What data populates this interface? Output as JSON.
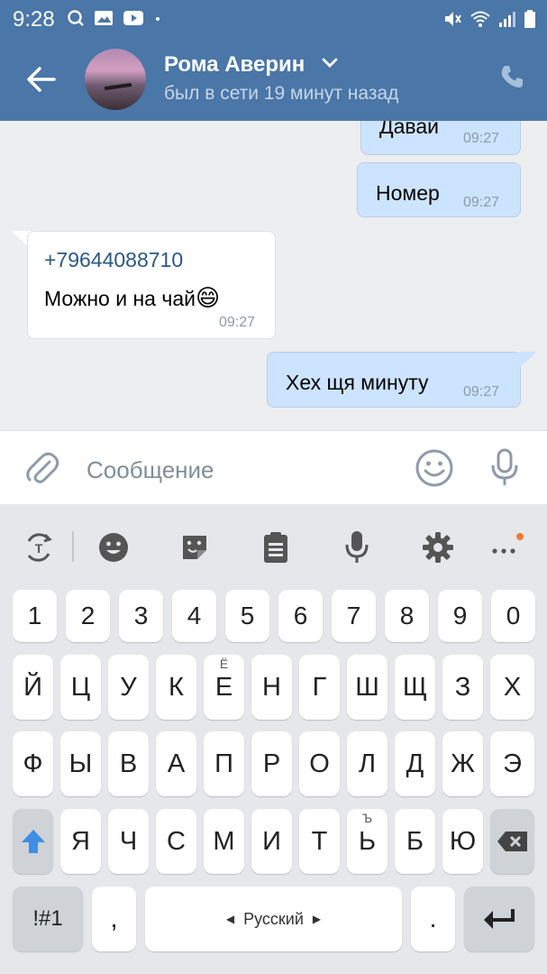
{
  "status_bar": {
    "time": "9:28"
  },
  "header": {
    "contact_name": "Рома Аверин",
    "last_seen": "был в сети 19 минут назад"
  },
  "messages": [
    {
      "direction": "out",
      "text": "Давай",
      "time": "09:27"
    },
    {
      "direction": "out",
      "text": "Номер",
      "time": "09:27"
    },
    {
      "direction": "in",
      "phone": "+79644088710",
      "text": "Можно и на чай",
      "emoji": "😄",
      "time": "09:27"
    },
    {
      "direction": "out",
      "text": "Хех щя минуту",
      "time": "09:27"
    }
  ],
  "composer": {
    "placeholder": "Сообщение"
  },
  "keyboard": {
    "toolbar_icons": [
      "translate-icon",
      "emoji-icon",
      "sticker-icon",
      "clipboard-icon",
      "voice-input-icon",
      "settings-icon",
      "more-icon"
    ],
    "number_row": [
      "1",
      "2",
      "3",
      "4",
      "5",
      "6",
      "7",
      "8",
      "9",
      "0"
    ],
    "row1": [
      "Й",
      "Ц",
      "У",
      "К",
      "Е",
      "Н",
      "Г",
      "Ш",
      "Щ",
      "З",
      "Х"
    ],
    "row1_secondary": {
      "4": "Ё"
    },
    "row2": [
      "Ф",
      "Ы",
      "В",
      "А",
      "П",
      "Р",
      "О",
      "Л",
      "Д",
      "Ж",
      "Э"
    ],
    "row3": [
      "Я",
      "Ч",
      "С",
      "М",
      "И",
      "Т",
      "Ь",
      "Б",
      "Ю"
    ],
    "row3_secondary": {
      "6": "Ъ"
    },
    "symbols_key": "!#1",
    "comma_key": ",",
    "space_label": "Русский",
    "period_key": ".",
    "colors": {
      "accent": "#4a76a8",
      "shift_active": "#3d8fe6",
      "notification_dot": "#f37a2c"
    }
  }
}
